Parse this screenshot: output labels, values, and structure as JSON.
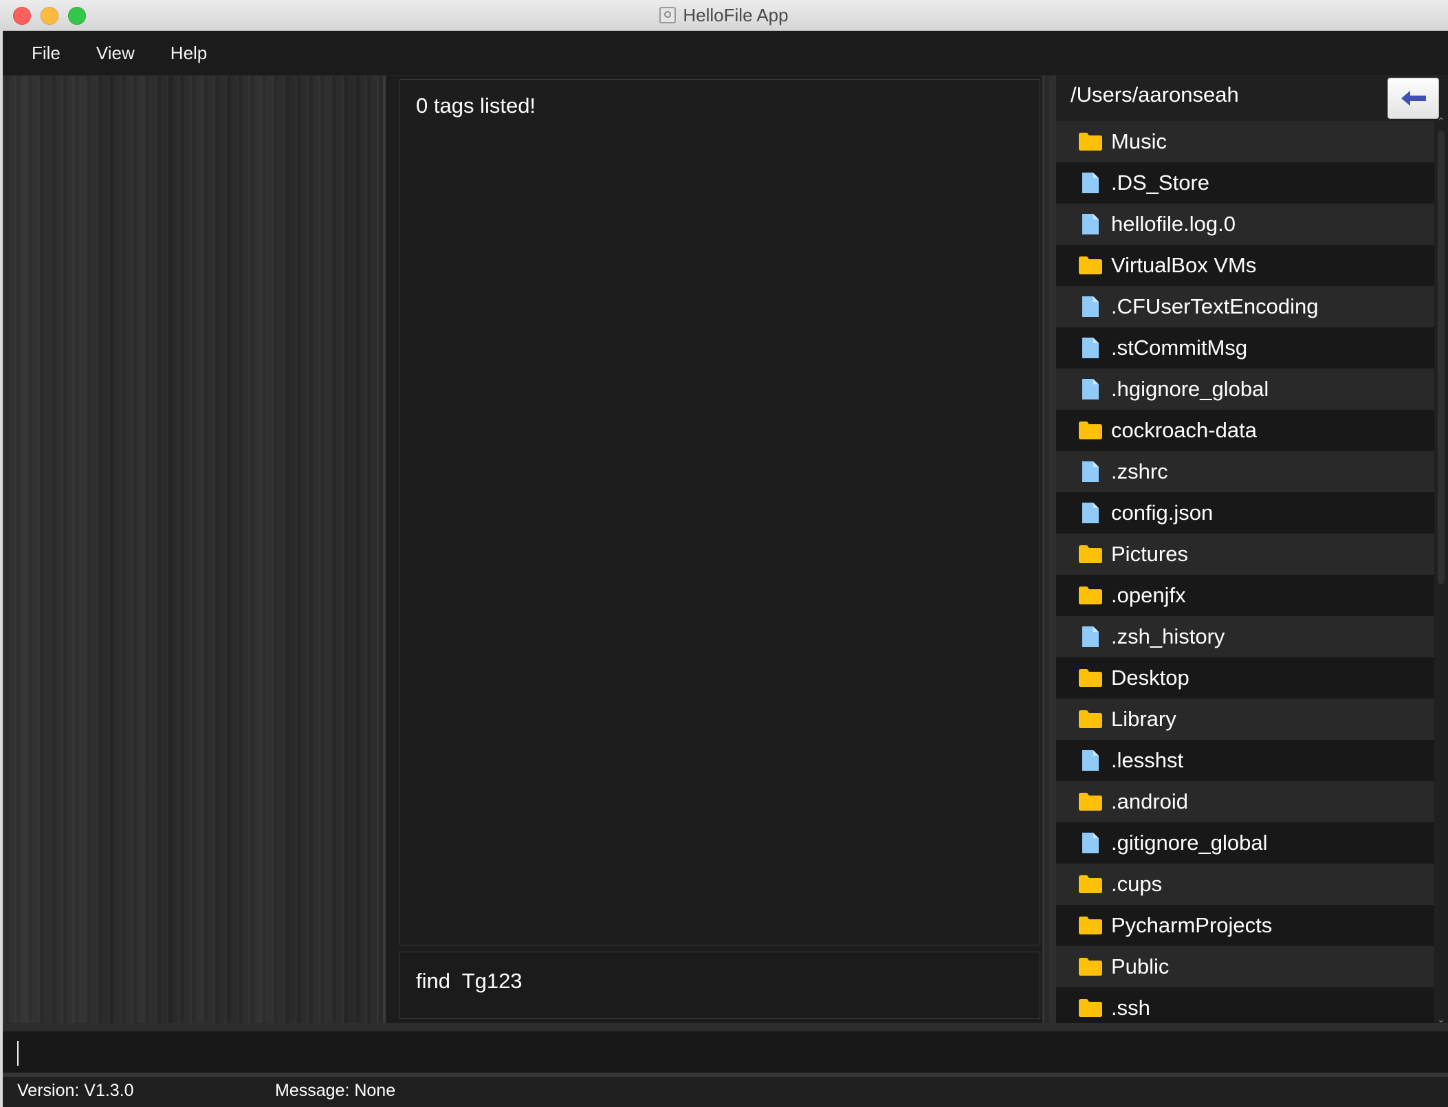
{
  "window": {
    "title": "HelloFile App"
  },
  "menu": {
    "items": [
      "File",
      "View",
      "Help"
    ]
  },
  "tags_panel": {
    "title": "0 tags listed!"
  },
  "command_history": {
    "text": "find  Tg123"
  },
  "file_browser": {
    "path": "/Users/aaronseah",
    "back_icon": "arrow-left-icon",
    "entries": [
      {
        "name": "Music",
        "type": "folder"
      },
      {
        "name": ".DS_Store",
        "type": "file"
      },
      {
        "name": "hellofile.log.0",
        "type": "file"
      },
      {
        "name": "VirtualBox VMs",
        "type": "folder"
      },
      {
        "name": ".CFUserTextEncoding",
        "type": "file"
      },
      {
        "name": ".stCommitMsg",
        "type": "file"
      },
      {
        "name": ".hgignore_global",
        "type": "file"
      },
      {
        "name": "cockroach-data",
        "type": "folder"
      },
      {
        "name": ".zshrc",
        "type": "file"
      },
      {
        "name": "config.json",
        "type": "file"
      },
      {
        "name": "Pictures",
        "type": "folder"
      },
      {
        "name": ".openjfx",
        "type": "folder"
      },
      {
        "name": ".zsh_history",
        "type": "file"
      },
      {
        "name": "Desktop",
        "type": "folder"
      },
      {
        "name": "Library",
        "type": "folder"
      },
      {
        "name": ".lesshst",
        "type": "file"
      },
      {
        "name": ".android",
        "type": "folder"
      },
      {
        "name": ".gitignore_global",
        "type": "file"
      },
      {
        "name": ".cups",
        "type": "folder"
      },
      {
        "name": "PycharmProjects",
        "type": "folder"
      },
      {
        "name": "Public",
        "type": "folder"
      },
      {
        "name": ".ssh",
        "type": "folder"
      }
    ]
  },
  "command_input": {
    "value": "",
    "placeholder": ""
  },
  "status": {
    "version": "Version: V1.3.0",
    "message": "Message: None"
  },
  "colors": {
    "folder": "#FFC107",
    "file": "#90CAF9",
    "back_arrow": "#3F51B5",
    "text": "#FFFFFF"
  }
}
